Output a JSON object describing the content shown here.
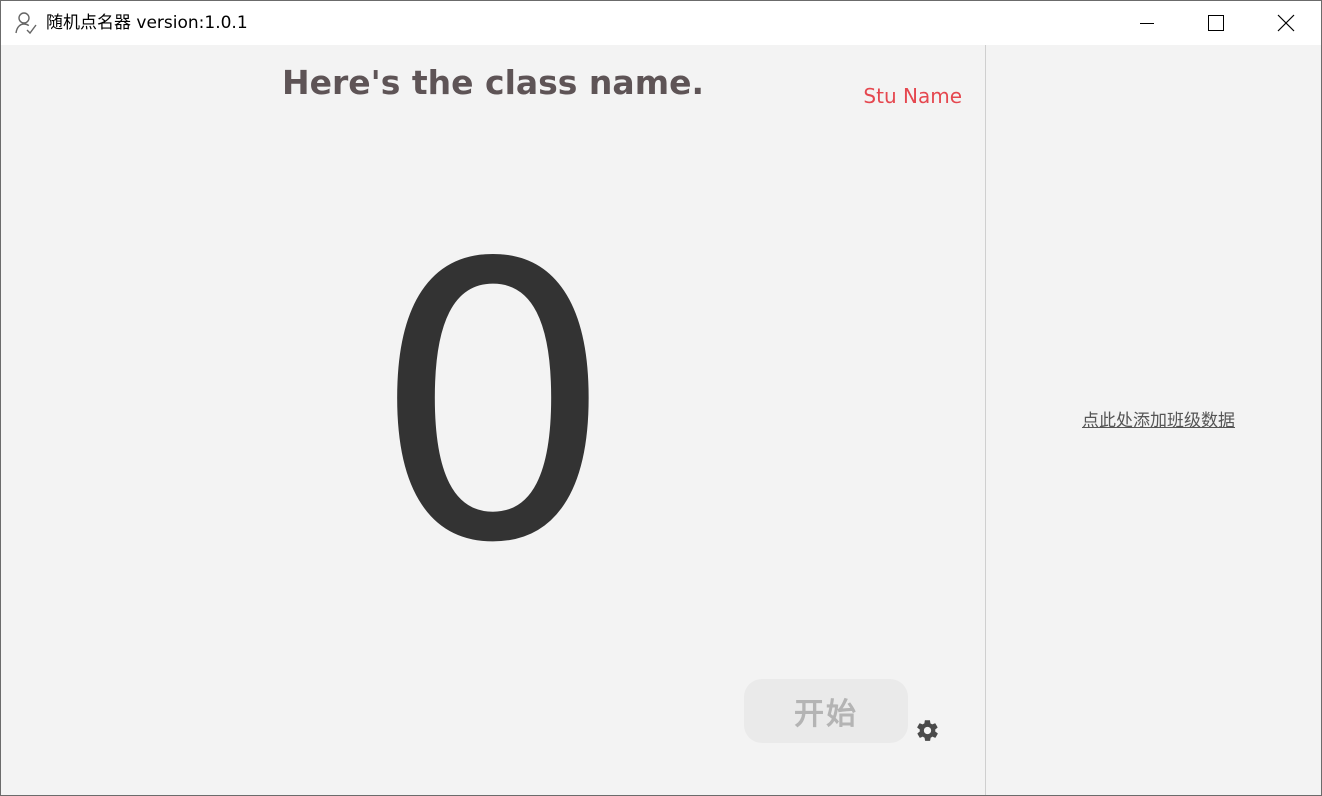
{
  "window": {
    "title": "随机点名器 version:1.0.1",
    "app_icon": "person-check-icon",
    "controls": {
      "minimize": "minimize-icon",
      "maximize": "maximize-icon",
      "close": "close-icon"
    }
  },
  "main": {
    "class_name": "Here's the class name.",
    "stu_name_label": "Stu Name",
    "current_number": "0",
    "start_button_label": "开始",
    "settings_icon": "gear-icon"
  },
  "side": {
    "add_class_link": "点此处添加班级数据"
  },
  "colors": {
    "background": "#f3f3f3",
    "titlebar": "#ffffff",
    "class_name": "#5e5456",
    "stu_name": "#e5474f",
    "number": "#333333",
    "start_button_bg": "#eaeaea",
    "start_button_text": "#b4b4b4",
    "link": "#555555"
  }
}
